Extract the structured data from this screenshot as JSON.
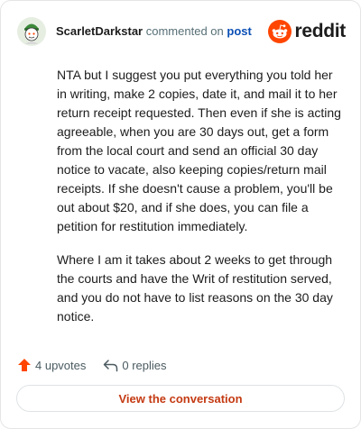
{
  "comment": {
    "username": "ScarletDarkstar",
    "action_text": "commented on",
    "post_link": "post",
    "paragraphs": [
      "NTA but I suggest you put everything you told her in writing, make 2 copies, date it, and mail it to her return receipt requested. Then even if she is acting agreeable, when you are 30 days out, get a form from the local court and send an official 30 day notice to vacate, also keeping copies/return mail receipts. If she doesn't cause a problem, you'll be out about $20, and if she does, you can file a petition for restitution immediately.",
      "Where I am it takes about 2 weeks to get through the courts and have the Writ of restitution served, and you do not have to list reasons on the 30 day notice."
    ]
  },
  "brand": {
    "name": "reddit",
    "icon": "reddit-snoo-icon",
    "color": "#ff4500"
  },
  "actions": {
    "upvotes": "4 upvotes",
    "replies": "0 replies",
    "upvote_icon": "upvote-arrow-icon",
    "reply_icon": "reply-arrow-icon",
    "upvote_color": "#ff4500"
  },
  "cta": {
    "label": "View the conversation",
    "color": "#c43a12"
  }
}
